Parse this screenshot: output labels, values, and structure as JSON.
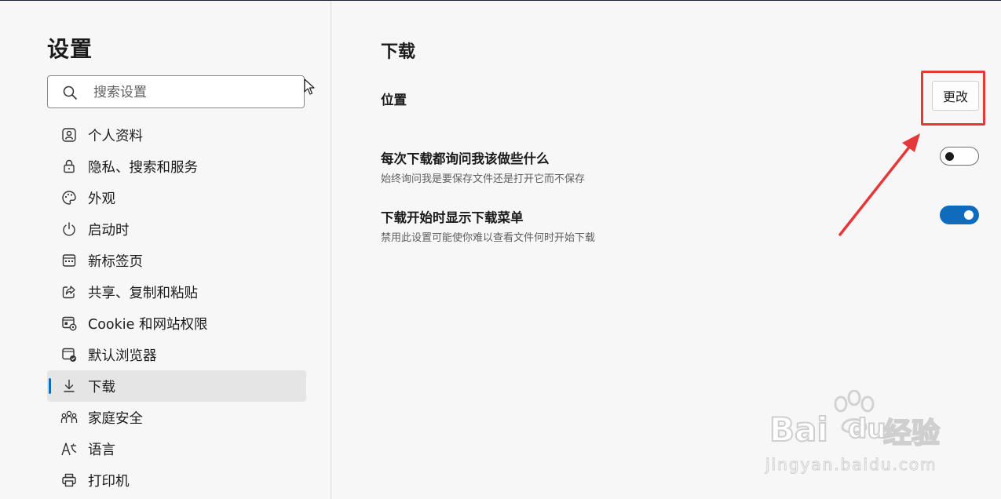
{
  "sidebar": {
    "title": "设置",
    "search_placeholder": "搜索设置",
    "items": [
      {
        "label": "个人资料",
        "icon": "profile-icon"
      },
      {
        "label": "隐私、搜索和服务",
        "icon": "lock-icon"
      },
      {
        "label": "外观",
        "icon": "palette-icon"
      },
      {
        "label": "启动时",
        "icon": "power-icon"
      },
      {
        "label": "新标签页",
        "icon": "new-tab-icon"
      },
      {
        "label": "共享、复制和粘贴",
        "icon": "share-icon"
      },
      {
        "label": "Cookie 和网站权限",
        "icon": "cookie-settings-icon"
      },
      {
        "label": "默认浏览器",
        "icon": "default-browser-icon"
      },
      {
        "label": "下载",
        "icon": "download-icon",
        "active": true
      },
      {
        "label": "家庭安全",
        "icon": "family-icon"
      },
      {
        "label": "语言",
        "icon": "language-icon"
      },
      {
        "label": "打印机",
        "icon": "printer-icon"
      }
    ]
  },
  "main": {
    "title": "下载",
    "location": {
      "label": "位置",
      "button": "更改"
    },
    "ask": {
      "title": "每次下载都询问我该做些什么",
      "subtitle": "始终询问我是要保存文件还是打开它而不保存",
      "enabled": false
    },
    "menu": {
      "title": "下载开始时显示下载菜单",
      "subtitle": "禁用此设置可能使你难以查看文件何时开始下载",
      "enabled": true
    }
  },
  "watermark": {
    "brand": "Bai",
    "brand2": "du",
    "product": "经验",
    "url": "jingyan.baidu.com"
  },
  "colors": {
    "accent": "#0f6cbd",
    "annotation": "#e53838",
    "background": "#f7f7f7"
  }
}
